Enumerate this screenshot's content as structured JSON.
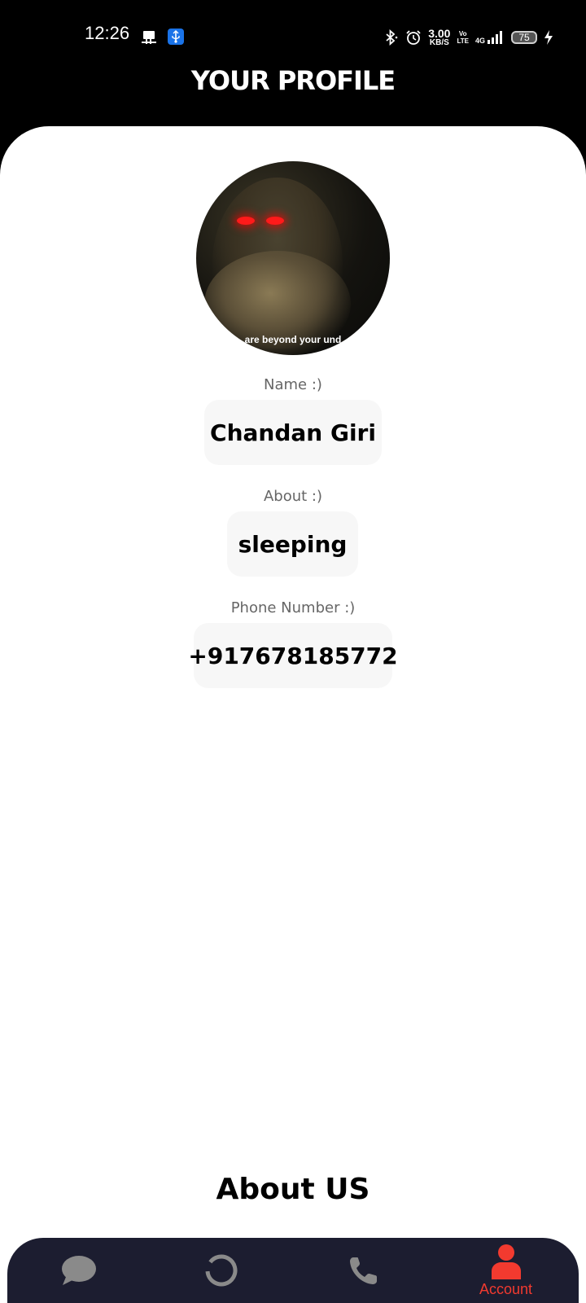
{
  "status_bar": {
    "time": "12:26",
    "net_speed_value": "3.00",
    "net_speed_unit": "KB/S",
    "volte_top": "Vo",
    "volte_bottom": "LTE",
    "network_type": "4G",
    "battery_level": "75"
  },
  "header": {
    "title": "YOUR PROFILE"
  },
  "profile": {
    "avatar_caption": "are beyond your und",
    "name_label": "Name :)",
    "name_value": "Chandan Giri",
    "about_label": "About :)",
    "about_value": "sleeping",
    "phone_label": "Phone Number :)",
    "phone_value": "+917678185772"
  },
  "about_us": {
    "title": "About US"
  },
  "bottom_nav": {
    "items": [
      {
        "id": "chats",
        "icon": "chat-bubble-icon",
        "label": ""
      },
      {
        "id": "status",
        "icon": "status-ring-icon",
        "label": ""
      },
      {
        "id": "calls",
        "icon": "phone-icon",
        "label": ""
      },
      {
        "id": "account",
        "icon": "account-icon",
        "label": "Account"
      }
    ],
    "active_color": "#f23a2f",
    "inactive_color": "#8a8a8a",
    "background_color": "#1c1d30"
  }
}
